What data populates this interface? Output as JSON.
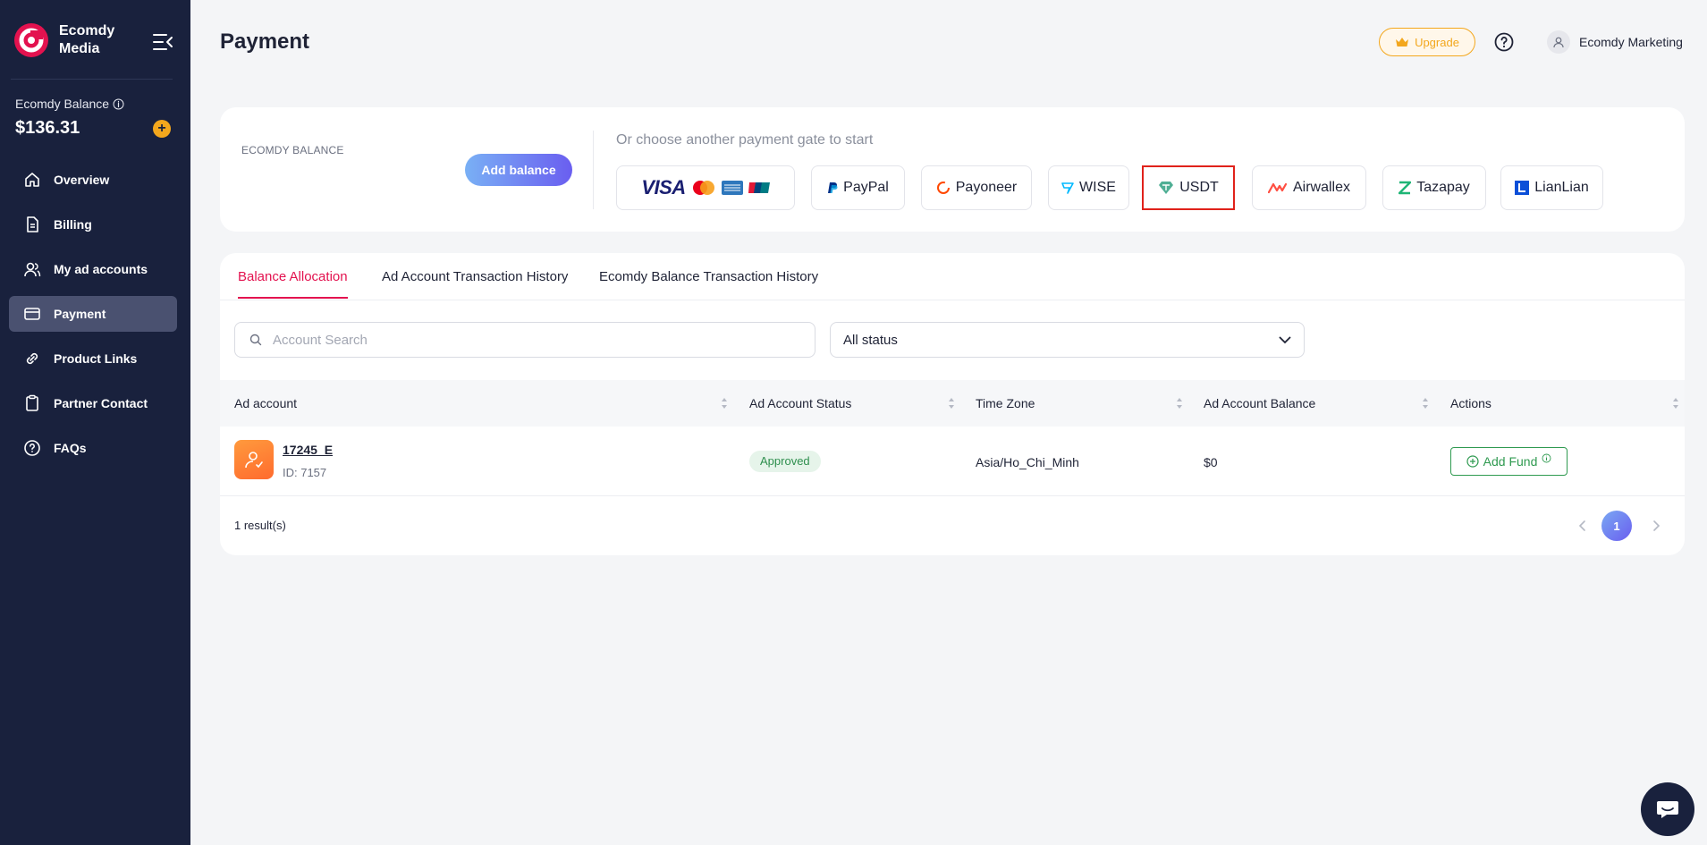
{
  "sidebar": {
    "brand_name": "Ecomdy Media",
    "balance_label": "Ecomdy Balance",
    "balance_amount": "$136.31",
    "items": [
      {
        "label": "Overview",
        "icon": "home-icon"
      },
      {
        "label": "Billing",
        "icon": "document-icon"
      },
      {
        "label": "My ad accounts",
        "icon": "users-icon"
      },
      {
        "label": "Payment",
        "icon": "card-icon"
      },
      {
        "label": "Product Links",
        "icon": "link-icon"
      },
      {
        "label": "Partner Contact",
        "icon": "clipboard-icon"
      },
      {
        "label": "FAQs",
        "icon": "question-icon"
      }
    ],
    "active_item": "Payment"
  },
  "header": {
    "title": "Payment",
    "upgrade_label": "Upgrade",
    "user_name": "Ecomdy Marketing"
  },
  "payment": {
    "balance_label": "ECOMDY BALANCE",
    "add_balance_label": "Add balance",
    "gate_caption": "Or choose another payment gate to start",
    "gates": [
      "PayPal",
      "Payoneer",
      "WISE",
      "USDT",
      "Airwallex",
      "Tazapay",
      "LianLian"
    ],
    "card_brands": "VISA",
    "selected_gate": "USDT"
  },
  "tabs": [
    "Balance Allocation",
    "Ad Account Transaction History",
    "Ecomdy Balance Transaction History"
  ],
  "filters": {
    "search_placeholder": "Account Search",
    "status_value": "All status"
  },
  "table": {
    "columns": [
      "Ad account",
      "Ad Account Status",
      "Time Zone",
      "Ad Account Balance",
      "Actions"
    ],
    "rows": [
      {
        "name": "17245_E",
        "id": "ID: 7157",
        "status": "Approved",
        "timezone": "Asia/Ho_Chi_Minh",
        "balance": "$0",
        "action": "Add Fund"
      }
    ],
    "results": "1 result(s)",
    "current_page": "1"
  },
  "colors": {
    "sidebar_bg": "#19213d",
    "accent_red": "#e3124f",
    "upgrade_orange": "#f3a71d",
    "success_green": "#2f9a50"
  }
}
